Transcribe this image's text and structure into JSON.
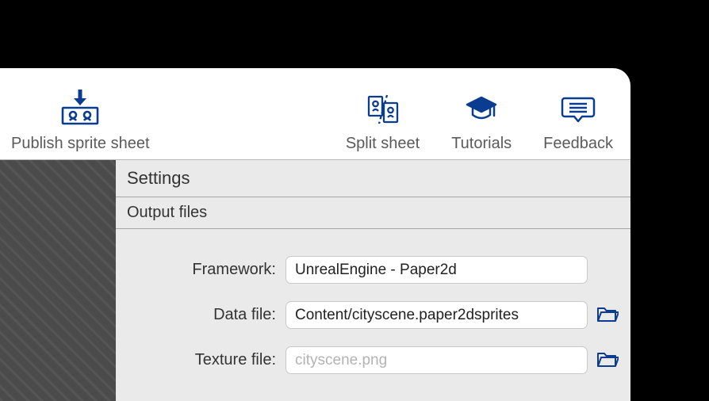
{
  "toolbar": {
    "publish_label": "Publish sprite sheet",
    "split_label": "Split sheet",
    "tutorials_label": "Tutorials",
    "feedback_label": "Feedback"
  },
  "settings": {
    "title": "Settings",
    "output_section": "Output files",
    "framework_label": "Framework:",
    "framework_value": "UnrealEngine - Paper2d",
    "datafile_label": "Data file:",
    "datafile_value": "Content/cityscene.paper2dsprites",
    "texturefile_label": "Texture file:",
    "texturefile_placeholder": "cityscene.png"
  },
  "colors": {
    "accent": "#0a3d8f"
  }
}
